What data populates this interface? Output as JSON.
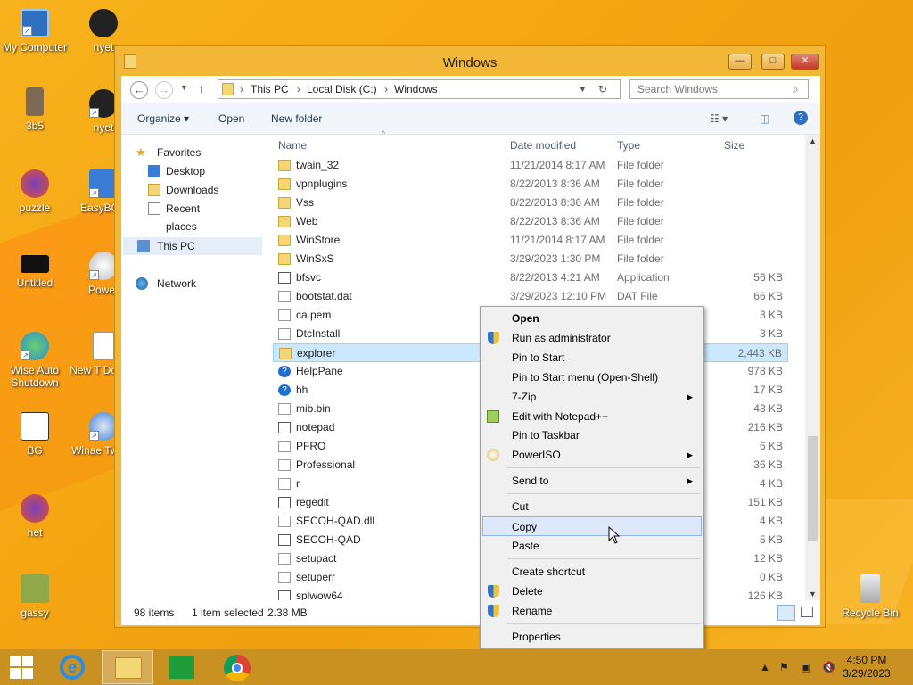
{
  "desktop": {
    "icons": [
      {
        "label": "My Computer"
      },
      {
        "label": "nyet"
      },
      {
        "label": "3b5"
      },
      {
        "label": "nyet"
      },
      {
        "label": "puzzle"
      },
      {
        "label": "EasyBCD"
      },
      {
        "label": "Untitled"
      },
      {
        "label": "Power"
      },
      {
        "label": "Wise Auto Shutdown"
      },
      {
        "label": "New T Docum"
      },
      {
        "label": "BG"
      },
      {
        "label": "Winae Tweak"
      },
      {
        "label": "het"
      },
      {
        "label": "gassy"
      },
      {
        "label": "Recycle Bin"
      }
    ]
  },
  "window": {
    "title": "Windows",
    "address": {
      "seg1": "This PC",
      "seg2": "Local Disk (C:)",
      "seg3": "Windows"
    },
    "search_placeholder": "Search Windows",
    "toolbar": {
      "organize": "Organize ▾",
      "open": "Open",
      "new_folder": "New folder"
    },
    "nav": {
      "favorites": "Favorites",
      "desktop": "Desktop",
      "downloads": "Downloads",
      "recent": "Recent places",
      "this_pc": "This PC",
      "network": "Network"
    },
    "columns": {
      "name": "Name",
      "date": "Date modified",
      "type": "Type",
      "size": "Size"
    },
    "files": [
      {
        "name": "twain_32",
        "date": "11/21/2014 8:17 AM",
        "type": "File folder",
        "size": "",
        "icon": "folder"
      },
      {
        "name": "vpnplugins",
        "date": "8/22/2013 8:36 AM",
        "type": "File folder",
        "size": "",
        "icon": "folder"
      },
      {
        "name": "Vss",
        "date": "8/22/2013 8:36 AM",
        "type": "File folder",
        "size": "",
        "icon": "folder"
      },
      {
        "name": "Web",
        "date": "8/22/2013 8:36 AM",
        "type": "File folder",
        "size": "",
        "icon": "folder"
      },
      {
        "name": "WinStore",
        "date": "11/21/2014 8:17 AM",
        "type": "File folder",
        "size": "",
        "icon": "folder"
      },
      {
        "name": "WinSxS",
        "date": "3/29/2023 1:30 PM",
        "type": "File folder",
        "size": "",
        "icon": "folder"
      },
      {
        "name": "bfsvc",
        "date": "8/22/2013 4:21 AM",
        "type": "Application",
        "size": "56 KB",
        "icon": "app"
      },
      {
        "name": "bootstat.dat",
        "date": "3/29/2023 12:10 PM",
        "type": "DAT File",
        "size": "66 KB",
        "icon": "file"
      },
      {
        "name": "ca.pem",
        "date": "",
        "type": "",
        "size": "3 KB",
        "icon": "file"
      },
      {
        "name": "DtcInstall",
        "date": "",
        "type": "",
        "size": "3 KB",
        "icon": "file"
      },
      {
        "name": "explorer",
        "date": "",
        "type": "",
        "size": "2,443 KB",
        "icon": "folder"
      },
      {
        "name": "HelpPane",
        "date": "",
        "type": "",
        "size": "978 KB",
        "icon": "help"
      },
      {
        "name": "hh",
        "date": "",
        "type": "",
        "size": "17 KB",
        "icon": "help"
      },
      {
        "name": "mib.bin",
        "date": "",
        "type": "",
        "size": "43 KB",
        "icon": "file"
      },
      {
        "name": "notepad",
        "date": "",
        "type": "",
        "size": "216 KB",
        "icon": "app"
      },
      {
        "name": "PFRO",
        "date": "",
        "type": "",
        "size": "6 KB",
        "icon": "file"
      },
      {
        "name": "Professional",
        "date": "",
        "type": "",
        "size": "36 KB",
        "icon": "file"
      },
      {
        "name": "r",
        "date": "",
        "type": "...",
        "size": "4 KB",
        "icon": "file"
      },
      {
        "name": "regedit",
        "date": "",
        "type": "",
        "size": "151 KB",
        "icon": "app"
      },
      {
        "name": "SECOH-QAD.dll",
        "date": "",
        "type": "...",
        "size": "4 KB",
        "icon": "file"
      },
      {
        "name": "SECOH-QAD",
        "date": "",
        "type": "",
        "size": "5 KB",
        "icon": "app"
      },
      {
        "name": "setupact",
        "date": "",
        "type": "",
        "size": "12 KB",
        "icon": "file"
      },
      {
        "name": "setuperr",
        "date": "",
        "type": "",
        "size": "0 KB",
        "icon": "file"
      },
      {
        "name": "splwow64",
        "date": "",
        "type": "",
        "size": "126 KB",
        "icon": "app"
      }
    ],
    "status": {
      "count": "98 items",
      "selected": "1 item selected",
      "size": "2.38 MB"
    }
  },
  "context_menu": {
    "items": [
      {
        "label": "Open",
        "bold": true
      },
      {
        "label": "Run as administrator",
        "shield": true
      },
      {
        "label": "Pin to Start"
      },
      {
        "label": "Pin to Start menu (Open-Shell)"
      },
      {
        "label": "7-Zip",
        "submenu": true
      },
      {
        "label": "Edit with Notepad++"
      },
      {
        "label": "Pin to Taskbar"
      },
      {
        "label": "PowerISO",
        "submenu": true
      },
      {
        "label": "Send to",
        "submenu": true
      },
      {
        "label": "Cut"
      },
      {
        "label": "Copy"
      },
      {
        "label": "Paste"
      },
      {
        "label": "Create shortcut"
      },
      {
        "label": "Delete",
        "shield": true
      },
      {
        "label": "Rename",
        "shield": true
      },
      {
        "label": "Properties"
      }
    ]
  },
  "taskbar": {
    "time": "4:50 PM",
    "date": "3/29/2023"
  },
  "colors": {
    "wallpaper": "#f5a512",
    "window_frame": "#f3b737",
    "selection": "#cce8ff",
    "menu_hover": "#dde9f8"
  }
}
